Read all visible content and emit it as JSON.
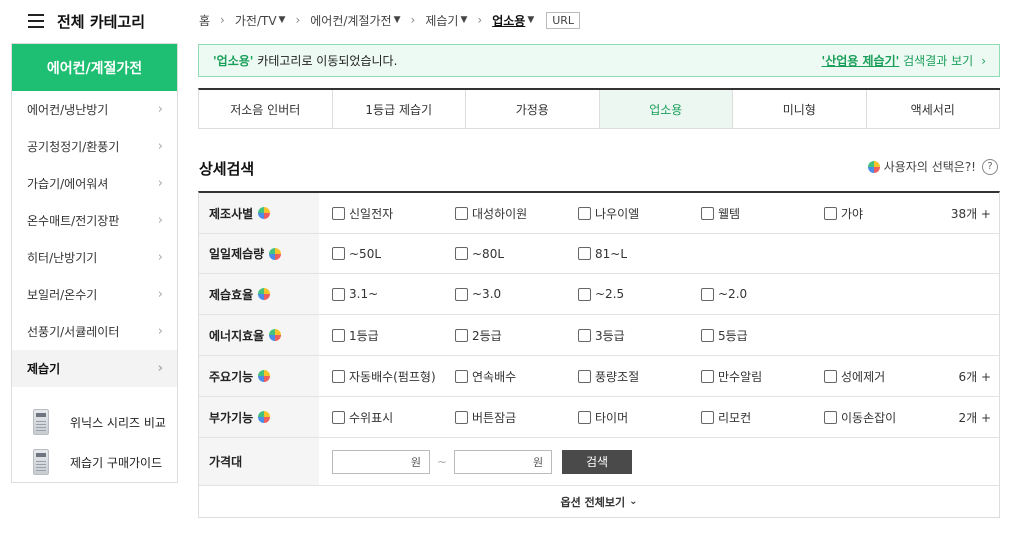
{
  "category_header": {
    "title": "전체 카테고리"
  },
  "sidebar": {
    "heading": "에어컨/계절가전",
    "items": [
      {
        "label": "에어컨/냉난방기"
      },
      {
        "label": "공기청정기/환풍기"
      },
      {
        "label": "가습기/에어워셔"
      },
      {
        "label": "온수매트/전기장판"
      },
      {
        "label": "히터/난방기기"
      },
      {
        "label": "보일러/온수기"
      },
      {
        "label": "선풍기/서큘레이터"
      },
      {
        "label": "제습기"
      }
    ],
    "guides": [
      {
        "label": "위닉스 시리즈 비교"
      },
      {
        "label": "제습기 구매가이드"
      }
    ]
  },
  "breadcrumb": {
    "items": [
      "홈",
      "가전/TV",
      "에어컨/계절가전",
      "제습기",
      "업소용"
    ],
    "url_button": "URL"
  },
  "notice": {
    "category": "'업소용'",
    "message": " 카테고리로 이동되었습니다.",
    "link_text": "'산업용 제습기'",
    "link_rest": " 검색결과 보기"
  },
  "tabs": [
    "저소음 인버터",
    "1등급 제습기",
    "가정용",
    "업소용",
    "미니형",
    "액세서리"
  ],
  "detail_search": {
    "title": "상세검색",
    "users_choice": "사용자의 선택은?!",
    "help": "?",
    "rows": [
      {
        "label": "제조사별",
        "options": [
          "신일전자",
          "대성하이원",
          "나우이엘",
          "웰템",
          "가야"
        ],
        "more": "38개 +"
      },
      {
        "label": "일일제습량",
        "options": [
          "~50L",
          "~80L",
          "81~L"
        ],
        "more": ""
      },
      {
        "label": "제습효율",
        "options": [
          "3.1~",
          "~3.0",
          "~2.5",
          "~2.0"
        ],
        "more": ""
      },
      {
        "label": "에너지효율",
        "options": [
          "1등급",
          "2등급",
          "3등급",
          "5등급"
        ],
        "more": ""
      },
      {
        "label": "주요기능",
        "options": [
          "자동배수(펌프형)",
          "연속배수",
          "풍량조절",
          "만수알림",
          "성에제거"
        ],
        "more": "6개 +"
      },
      {
        "label": "부가기능",
        "options": [
          "수위표시",
          "버튼잠금",
          "타이머",
          "리모컨",
          "이동손잡이"
        ],
        "more": "2개 +"
      }
    ],
    "price": {
      "label": "가격대",
      "min_unit": "원",
      "tilde": "~",
      "max_unit": "원",
      "search_button": "검색"
    },
    "expand_label": "옵션 전체보기"
  }
}
